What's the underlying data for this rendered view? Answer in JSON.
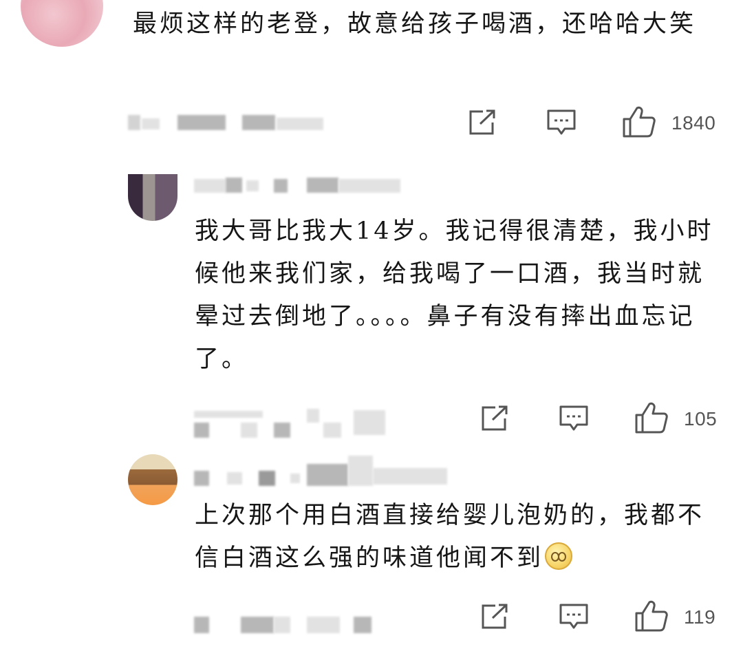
{
  "comments": [
    {
      "text": "最烦这样的老登，故意给孩子喝酒，还哈哈大笑",
      "likes": "1840"
    },
    {
      "text": "我大哥比我大14岁。我记得很清楚，我小时候他来我们家，给我喝了一口酒，我当时就晕过去倒地了。。。。鼻子有没有摔出血忘记了。",
      "likes": "105"
    },
    {
      "text": "上次那个用白酒直接给婴儿泡奶的，我都不信白酒这么强的味道他闻不到",
      "likes": "119"
    }
  ],
  "icons": {
    "share": "share-icon",
    "reply": "comment-icon",
    "like": "thumbs-up-icon",
    "emoji": "drooling-face-emoji"
  },
  "colors": {
    "text": "#161616",
    "icon": "#555555",
    "background": "#ffffff"
  }
}
